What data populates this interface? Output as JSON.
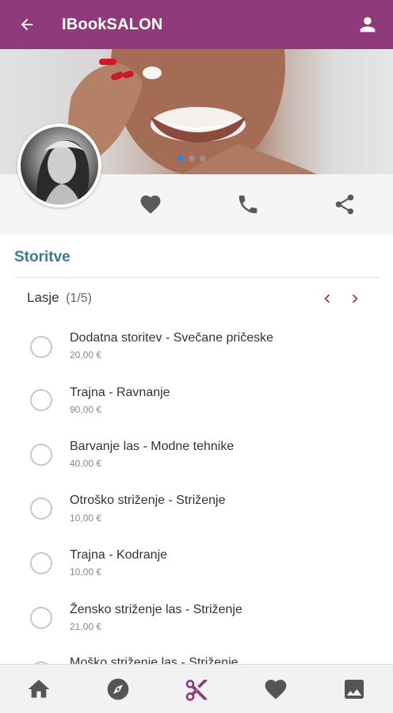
{
  "appbar": {
    "title": "IBookSALON",
    "back_icon": "arrow-left-icon",
    "user_icon": "account-icon"
  },
  "hero": {
    "carousel_page": 1,
    "carousel_total": 3
  },
  "actions": {
    "favorite_icon": "heart-icon",
    "call_icon": "phone-icon",
    "share_icon": "share-icon"
  },
  "section": {
    "title": "Storitve"
  },
  "category": {
    "name": "Lasje",
    "count": "(1/5)"
  },
  "services": [
    {
      "name": "Dodatna storitev - Svečane pričeske",
      "price": "20,00 €"
    },
    {
      "name": "Trajna - Ravnanje",
      "price": "90,00 €"
    },
    {
      "name": "Barvanje las - Modne tehnike",
      "price": "40,00 €"
    },
    {
      "name": "Otroško striženje - Striženje",
      "price": "10,00 €"
    },
    {
      "name": "Trajna - Kodranje",
      "price": "10,00 €"
    },
    {
      "name": "Žensko striženje las - Striženje",
      "price": "21,00 €"
    },
    {
      "name": "Moško striženje las - Striženje",
      "price": ""
    }
  ],
  "bottom_nav": [
    {
      "icon": "home-icon",
      "active": false
    },
    {
      "icon": "compass-icon",
      "active": false
    },
    {
      "icon": "scissors-icon",
      "active": true
    },
    {
      "icon": "heart-icon",
      "active": false
    },
    {
      "icon": "gallery-icon",
      "active": false
    }
  ],
  "colors": {
    "primary": "#8e3a7b",
    "section_title": "#3a7c8e",
    "carousel_active_dot": "#2a8ad8",
    "icon_gray": "#555555"
  }
}
